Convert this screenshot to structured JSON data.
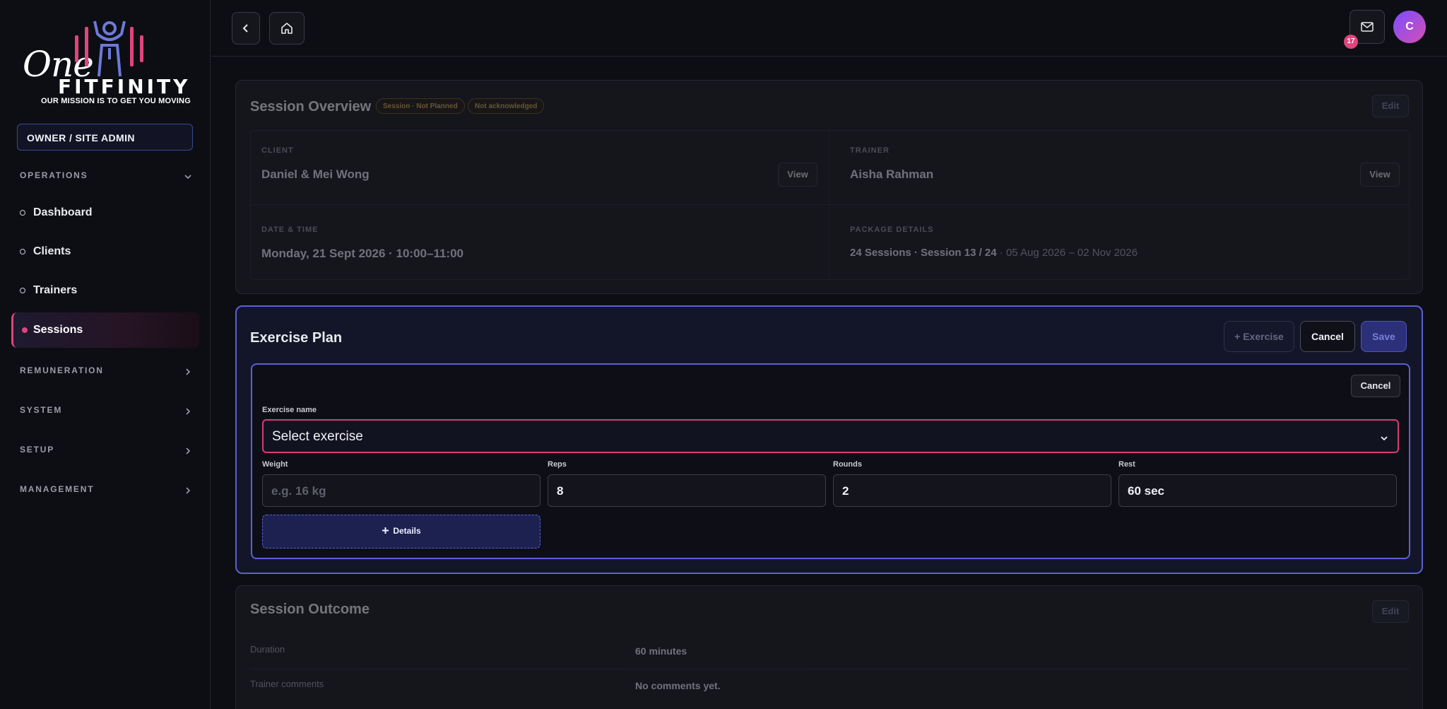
{
  "brand": {
    "logo_one": "One",
    "logo_word": "FITFINITY",
    "tagline": "OUR MISSION IS TO GET YOU MOVING"
  },
  "sidebar": {
    "role": "OWNER / SITE ADMIN",
    "sections": [
      {
        "label": "OPERATIONS",
        "icon": "chevron-down-icon"
      },
      {
        "label": "REMUNERATION",
        "icon": "chevron-right-icon"
      },
      {
        "label": "SYSTEM",
        "icon": "chevron-right-icon"
      },
      {
        "label": "SETUP",
        "icon": "chevron-right-icon"
      },
      {
        "label": "MANAGEMENT",
        "icon": "chevron-right-icon"
      }
    ],
    "items": [
      {
        "label": "Dashboard"
      },
      {
        "label": "Clients"
      },
      {
        "label": "Trainers"
      },
      {
        "label": "Sessions",
        "active": true
      }
    ]
  },
  "topbar": {
    "back_icon": "chevron-left-icon",
    "home_icon": "home-icon",
    "mail_icon": "mail-icon",
    "notification_count": "17",
    "avatar_initial": "C"
  },
  "overview": {
    "title": "Session Overview",
    "status_pill": "Session · Not Planned",
    "ack_pill": "Not acknowledged",
    "edit_label": "Edit",
    "client_label": "CLIENT",
    "client_value": "Daniel & Mei Wong",
    "trainer_label": "TRAINER",
    "trainer_value": "Aisha Rahman",
    "view_label": "View",
    "datetime_label": "DATE & TIME",
    "datetime_value": "Monday, 21 Sept 2026 · 10:00–11:00",
    "package_label": "PACKAGE DETAILS",
    "package_value": "24 Sessions · Session 13 / 24",
    "package_dates": " · 05 Aug 2026 – 02 Nov 2026"
  },
  "exercise_plan": {
    "title": "Exercise Plan",
    "add_label": "+ Exercise",
    "cancel_label": "Cancel",
    "save_label": "Save",
    "inner_cancel_label": "Cancel",
    "name_label": "Exercise name",
    "select_value": "Select exercise",
    "weight_label": "Weight",
    "weight_placeholder": "e.g. 16 kg",
    "reps_label": "Reps",
    "reps_value": "8",
    "rounds_label": "Rounds",
    "rounds_value": "2",
    "rest_label": "Rest",
    "rest_value": "60 sec",
    "details_label": "Details"
  },
  "outcome": {
    "title": "Session Outcome",
    "edit_label": "Edit",
    "duration_label": "Duration",
    "duration_value": "60 minutes",
    "comments_label": "Trainer comments",
    "comments_value": "No comments yet."
  },
  "colors": {
    "accent": "#e0457b",
    "primary": "#5b60d6",
    "background": "#0d0e13"
  }
}
